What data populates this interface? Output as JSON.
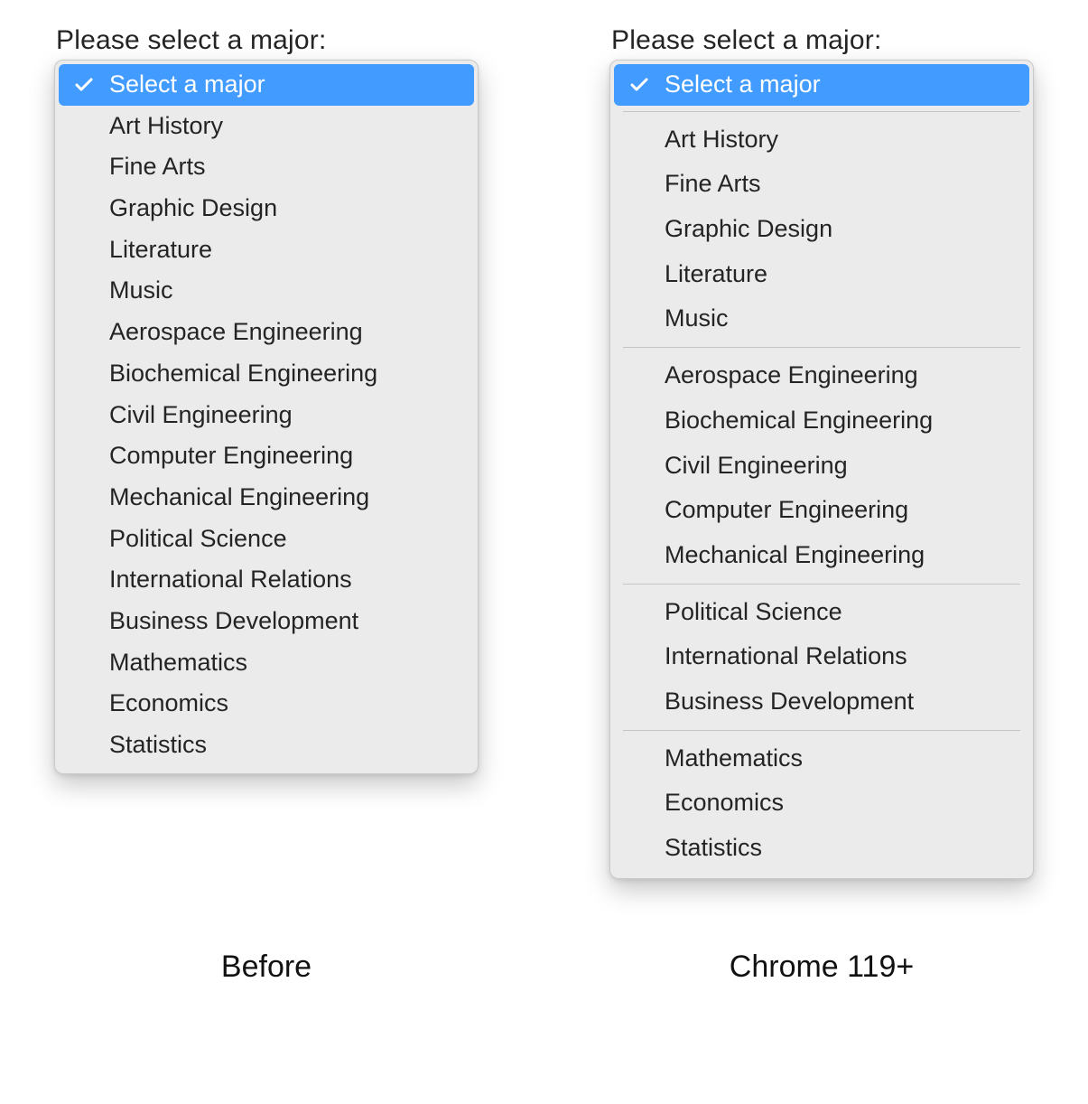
{
  "left": {
    "label": "Please select a major:",
    "caption": "Before",
    "selected": "Select a major",
    "items": [
      "Art History",
      "Fine Arts",
      "Graphic Design",
      "Literature",
      "Music",
      "Aerospace Engineering",
      "Biochemical Engineering",
      "Civil Engineering",
      "Computer Engineering",
      "Mechanical Engineering",
      "Political Science",
      "International Relations",
      "Business Development",
      "Mathematics",
      "Economics",
      "Statistics"
    ]
  },
  "right": {
    "label": "Please select a major:",
    "caption": "Chrome 119+",
    "selected": "Select a major",
    "groups": [
      [
        "Art History",
        "Fine Arts",
        "Graphic Design",
        "Literature",
        "Music"
      ],
      [
        "Aerospace Engineering",
        "Biochemical Engineering",
        "Civil Engineering",
        "Computer Engineering",
        "Mechanical Engineering"
      ],
      [
        "Political Science",
        "International Relations",
        "Business Development"
      ],
      [
        "Mathematics",
        "Economics",
        "Statistics"
      ]
    ]
  }
}
